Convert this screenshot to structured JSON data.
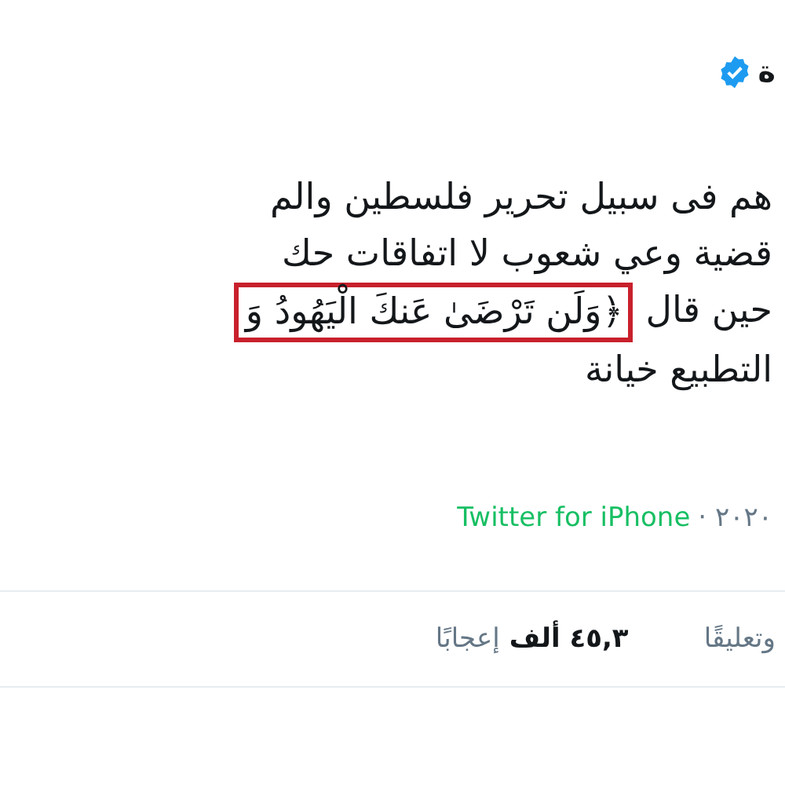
{
  "author": {
    "name": "ة",
    "verified": true
  },
  "tweet": {
    "lines": [
      {
        "text": "هم فى سبيل تحرير فلسطين والم"
      },
      {
        "text": "قضية وعي شعوب لا اتفاقات حك"
      },
      {
        "text": "حين قال",
        "quote": "﴿وَلَن تَرْضَىٰ عَنكَ الْيَهُودُ وَ"
      },
      {
        "text": "التطبيع خيانة"
      }
    ]
  },
  "meta": {
    "date": "٢٠٢٠ ·",
    "source": "Twitter for iPhone"
  },
  "stats": [
    {
      "label": "وتعليقًا"
    },
    {
      "count": "٤٥,٣ ألف",
      "label": "إعجابًا"
    }
  ]
}
